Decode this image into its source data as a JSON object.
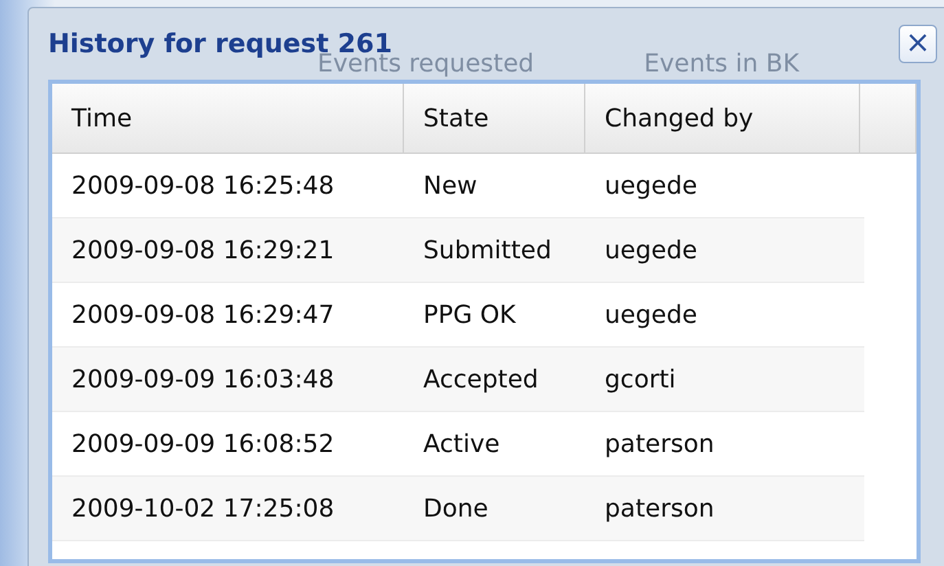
{
  "background": {
    "column_headers": [
      "Events requested",
      "Events in BK"
    ]
  },
  "dialog": {
    "title": "History for request 261",
    "close": "×"
  },
  "table": {
    "columns": [
      "Time",
      "State",
      "Changed by"
    ],
    "rows": [
      {
        "time": "2009-09-08 16:25:48",
        "state": "New",
        "changed_by": "uegede"
      },
      {
        "time": "2009-09-08 16:29:21",
        "state": "Submitted",
        "changed_by": "uegede"
      },
      {
        "time": "2009-09-08 16:29:47",
        "state": "PPG OK",
        "changed_by": "uegede"
      },
      {
        "time": "2009-09-09 16:03:48",
        "state": "Accepted",
        "changed_by": "gcorti"
      },
      {
        "time": "2009-09-09 16:08:52",
        "state": "Active",
        "changed_by": "paterson"
      },
      {
        "time": "2009-10-02 17:25:08",
        "state": "Done",
        "changed_by": "paterson"
      }
    ]
  }
}
